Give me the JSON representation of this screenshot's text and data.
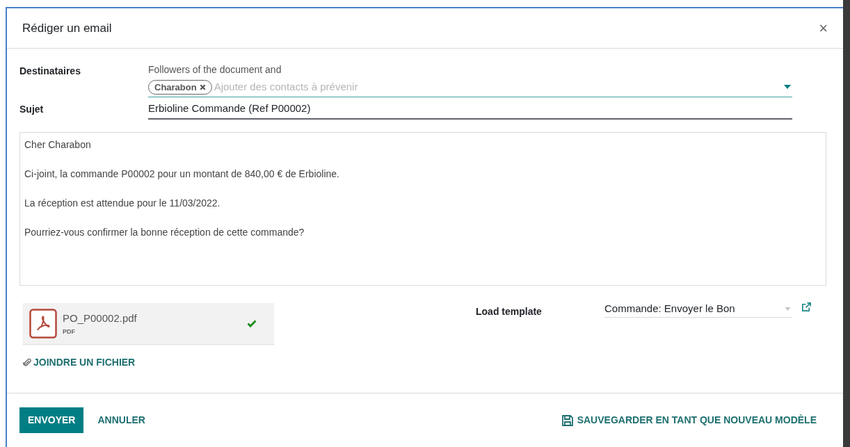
{
  "dialog": {
    "title": "Rédiger un email",
    "close": "×"
  },
  "recipients": {
    "label": "Destinataires",
    "note": "Followers of the document and",
    "tags": [
      {
        "label": "Charabon"
      }
    ],
    "placeholder": "Ajouter des contacts à prévenir"
  },
  "subject": {
    "label": "Sujet",
    "value": "Erbioline Commande (Ref P00002)"
  },
  "body": [
    "Cher Charabon",
    "Ci-joint, la commande P00002 pour un montant de 840,00 € de Erbioline.",
    "La réception est attendue pour le 11/03/2022.",
    "Pourriez-vous confirmer la bonne réception de cette commande?"
  ],
  "attachments": [
    {
      "name": "PO_P00002.pdf",
      "type": "PDF",
      "uploaded": true
    }
  ],
  "attach_link": "JOINDRE UN FICHIER",
  "template": {
    "label": "Load template",
    "value": "Commande: Envoyer le Bon"
  },
  "footer": {
    "send": "ENVOYER",
    "cancel": "ANNULER",
    "save_template": "SAUVEGARDER EN TANT QUE NOUVEAU MODÈLE"
  }
}
